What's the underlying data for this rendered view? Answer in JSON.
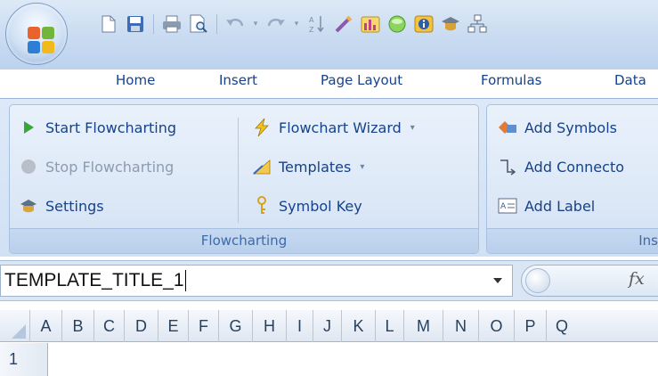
{
  "qat": {
    "icons": [
      "new-document-icon",
      "save-icon",
      "print-icon",
      "print-preview-icon",
      "undo-icon",
      "redo-icon",
      "sort-icon",
      "spelling-icon",
      "chart-icon",
      "green-circle-icon",
      "info-icon",
      "hat-icon",
      "org-chart-icon"
    ]
  },
  "tabs": [
    "Home",
    "Insert",
    "Page Layout",
    "Formulas",
    "Data"
  ],
  "ribbon": {
    "groups": [
      {
        "label": "Flowcharting",
        "commands": {
          "start": "Start Flowcharting",
          "stop": "Stop Flowcharting",
          "settings": "Settings",
          "wizard": "Flowchart Wizard",
          "templates": "Templates",
          "symbol_key": "Symbol Key"
        }
      },
      {
        "label": "Ins",
        "commands": {
          "add_symbols": "Add Symbols",
          "add_connector": "Add Connecto",
          "add_label": "Add Label"
        }
      }
    ]
  },
  "formula_bar": {
    "name_box_value": "TEMPLATE_TITLE_1",
    "fx_label": "fx"
  },
  "grid": {
    "columns": [
      "A",
      "B",
      "C",
      "D",
      "E",
      "F",
      "G",
      "H",
      "I",
      "J",
      "K",
      "L",
      "M",
      "N",
      "O",
      "P",
      "Q"
    ],
    "rows": [
      "1"
    ]
  },
  "colors": {
    "accent": "#15428b",
    "ribbon_bg": "#dbe7f6",
    "disabled_text": "#8d9bb0"
  }
}
